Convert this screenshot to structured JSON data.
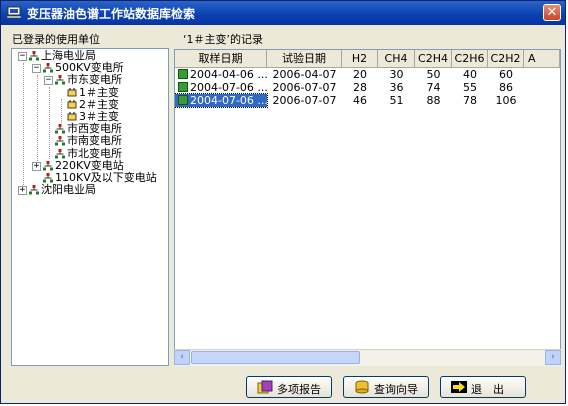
{
  "window": {
    "title": "变压器油色谱工作站数据库检索",
    "close": "✕"
  },
  "left": {
    "label": "已登录的使用单位",
    "tree": [
      {
        "text": "上海电业局",
        "level": 0,
        "expander": "−"
      },
      {
        "text": "500KV变电所",
        "level": 1,
        "expander": "−"
      },
      {
        "text": "市东变电所",
        "level": 2,
        "expander": "−"
      },
      {
        "text": "1＃主变",
        "level": 3,
        "expander": ""
      },
      {
        "text": "2＃主变",
        "level": 3,
        "expander": ""
      },
      {
        "text": "3＃主变",
        "level": 3,
        "expander": ""
      },
      {
        "text": "市西变电所",
        "level": 2,
        "expander": ""
      },
      {
        "text": "市南变电所",
        "level": 2,
        "expander": ""
      },
      {
        "text": "市北变电所",
        "level": 2,
        "expander": ""
      },
      {
        "text": "220KV变电站",
        "level": 1,
        "expander": "+"
      },
      {
        "text": "110KV及以下变电站",
        "level": 1,
        "expander": ""
      },
      {
        "text": "沈阳电业局",
        "level": 0,
        "expander": "+"
      }
    ]
  },
  "right": {
    "label": "‘1＃主变’的记录",
    "columns": [
      "取样日期",
      "试验日期",
      "H2",
      "CH4",
      "C2H4",
      "C2H6",
      "C2H2",
      "A"
    ],
    "rows": [
      [
        "2004-04-06 ...",
        "2006-04-07",
        "20",
        "30",
        "50",
        "40",
        "60"
      ],
      [
        "2004-07-06 ...",
        "2006-07-07",
        "28",
        "36",
        "74",
        "55",
        "86"
      ],
      [
        "2004-07-06 ...",
        "2006-07-07",
        "46",
        "51",
        "88",
        "78",
        "106"
      ]
    ],
    "selected_row": 2
  },
  "scrollbar": {
    "left_arrow": "‹",
    "right_arrow": "›"
  },
  "buttons": {
    "report": "多项报告",
    "wizard": "查询向导",
    "exit": "退　出"
  },
  "colors": {
    "titlebar": "#0a3fb0",
    "selection": "#316ac5",
    "tree_icon": "#c02010",
    "dialog_bg": "#ece9d8"
  }
}
